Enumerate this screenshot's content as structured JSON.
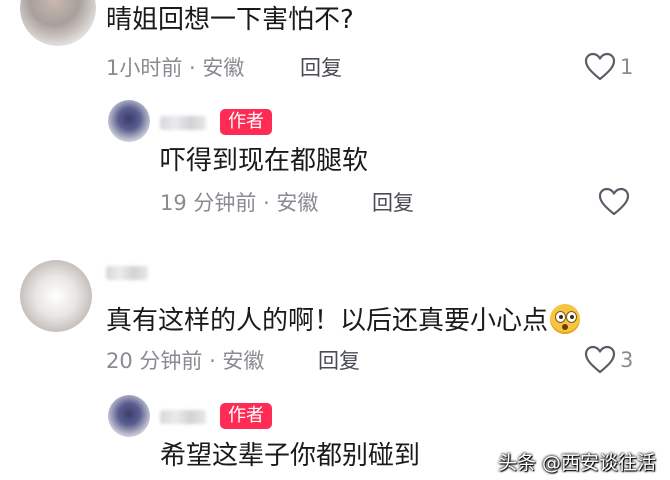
{
  "comments": [
    {
      "text": "晴姐回想一下害怕不?",
      "meta": "1小时前 · 安徽",
      "reply_label": "回复",
      "likes": "1"
    },
    {
      "author_badge": "作者",
      "text": "吓得到现在都腿软",
      "meta": "19 分钟前 · 安徽",
      "reply_label": "回复"
    },
    {
      "text": "真有这样的人的啊！以后还真要小心点",
      "emoji": "astonished-face-emoji",
      "meta": "20 分钟前 · 安徽",
      "reply_label": "回复",
      "likes": "3"
    },
    {
      "author_badge": "作者",
      "text": "希望这辈子你都别碰到"
    }
  ],
  "watermark": "头条 @西安谈往活",
  "icons": {
    "like": "heart-outline-icon"
  },
  "colors": {
    "author_badge": "#fe2c55",
    "meta_text": "#8a8b91"
  }
}
